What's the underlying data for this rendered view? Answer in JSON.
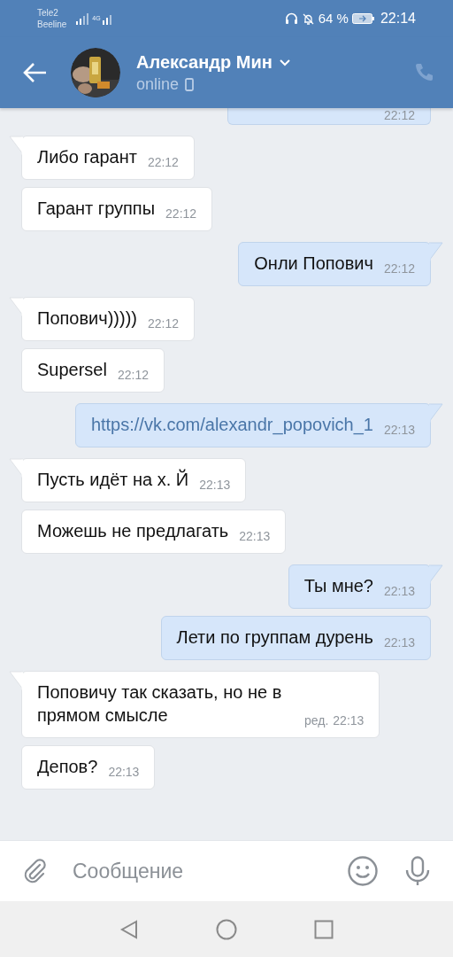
{
  "status_bar": {
    "carrier_1": "Tele2",
    "carrier_2": "Beeline",
    "network": "4G",
    "battery": "64 %",
    "time": "22:14"
  },
  "header": {
    "name": "Александр Мин",
    "status": "online"
  },
  "messages": [
    {
      "kind": "out",
      "tail": false,
      "partial": true,
      "time": "22:12"
    },
    {
      "kind": "in",
      "tail": true,
      "text": "Либо гарант",
      "time": "22:12"
    },
    {
      "kind": "in",
      "tail": false,
      "text": "Гарант группы",
      "time": "22:12"
    },
    {
      "kind": "out",
      "tail": true,
      "text": "Онли Попович",
      "time": "22:12"
    },
    {
      "kind": "in",
      "tail": true,
      "text": "Попович)))))",
      "time": "22:12"
    },
    {
      "kind": "in",
      "tail": false,
      "text": "Supersel",
      "time": "22:12"
    },
    {
      "kind": "out",
      "tail": true,
      "link": true,
      "text": "https://vk.com/alexandr_popovich_1",
      "time": "22:13"
    },
    {
      "kind": "in",
      "tail": true,
      "text": "Пусть идёт на х. Й",
      "time": "22:13"
    },
    {
      "kind": "in",
      "tail": false,
      "text": "Можешь не предлагать",
      "time": "22:13"
    },
    {
      "kind": "out",
      "tail": true,
      "text": "Ты мне?",
      "time": "22:13"
    },
    {
      "kind": "out",
      "tail": false,
      "text": "Лети по группам дурень",
      "time": "22:13"
    },
    {
      "kind": "in",
      "tail": true,
      "text": "Поповичу так сказать, но не в прямом смысле",
      "edited": "ред.",
      "time": "22:13"
    },
    {
      "kind": "in",
      "tail": false,
      "text": "Депов?",
      "time": "22:13"
    }
  ],
  "composer": {
    "placeholder": "Сообщение"
  }
}
